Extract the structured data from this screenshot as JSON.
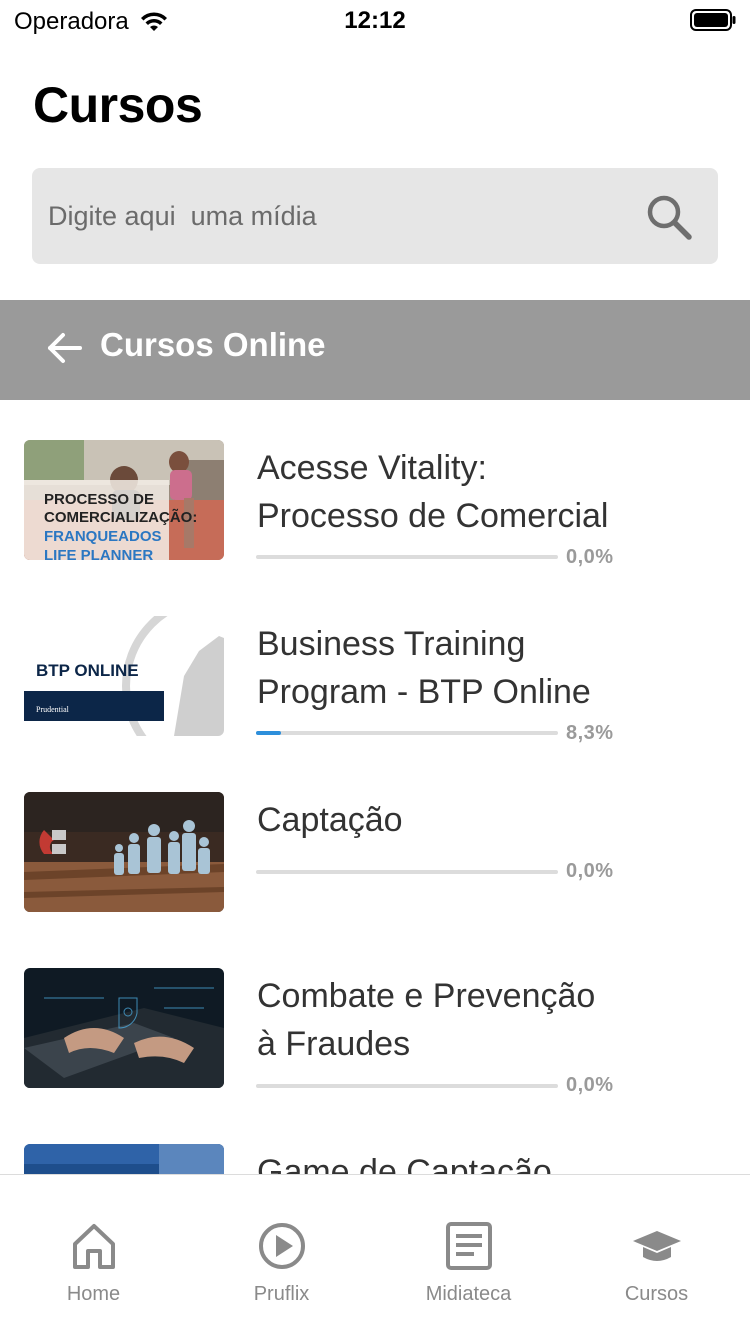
{
  "status_bar": {
    "carrier": "Operadora",
    "time": "12:12",
    "wifi_icon": "wifi-icon",
    "battery_icon": "battery-icon"
  },
  "page": {
    "title": "Cursos"
  },
  "search": {
    "placeholder": "Digite aqui  uma mídia",
    "value": "",
    "icon": "search-icon"
  },
  "section": {
    "title": "Cursos Online",
    "back_icon": "arrow-left-icon"
  },
  "courses": [
    {
      "title_line1": "Acesse Vitality:",
      "title_line2": "Processo de Comercial",
      "progress_label": "0,0%",
      "progress": 0.0,
      "thumb": {
        "line1": "PROCESSO DE",
        "line2": "COMERCIALIZAÇÃO:",
        "line3": "FRANQUEADOS",
        "line4": "LIFE PLANNER"
      }
    },
    {
      "title_line1": "Business Training",
      "title_line2": "Program - BTP Online",
      "progress_label": "8,3%",
      "progress": 0.083,
      "thumb": {
        "line1": "BTP ONLINE",
        "line2": "Prudential"
      }
    },
    {
      "title_line1": "Captação",
      "title_line2": "",
      "progress_label": "0,0%",
      "progress": 0.0
    },
    {
      "title_line1": "Combate e Prevenção",
      "title_line2": "à Fraudes",
      "progress_label": "0,0%",
      "progress": 0.0
    },
    {
      "title_line1": "Game de Captação",
      "title_line2": "",
      "progress_label": "",
      "progress": null
    }
  ],
  "tabs": [
    {
      "label": "Home",
      "icon": "home-icon"
    },
    {
      "label": "Pruflix",
      "icon": "play-circle-icon"
    },
    {
      "label": "Midiateca",
      "icon": "document-icon"
    },
    {
      "label": "Cursos",
      "icon": "graduation-cap-icon",
      "active": true
    }
  ],
  "colors": {
    "section_header_bg": "#9a9a9a",
    "progress_fill": "#2d8fdb",
    "progress_track": "#dcdcdc",
    "tab_inactive": "#8a8a8a",
    "search_bg": "#e6e6e6"
  }
}
